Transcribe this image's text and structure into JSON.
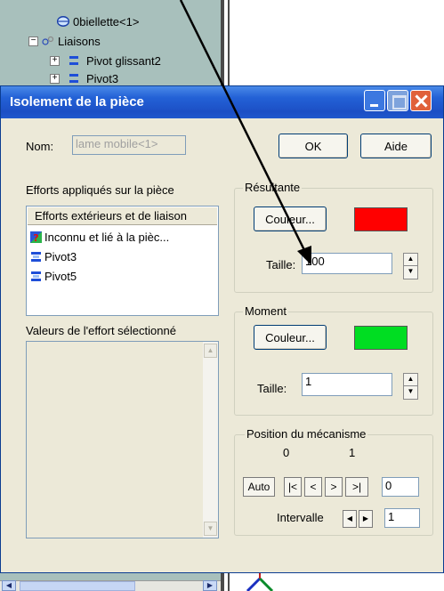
{
  "tree": {
    "items": [
      {
        "label": "0biellette<1>"
      },
      {
        "label": "Liaisons"
      },
      {
        "label": "Pivot glissant2"
      },
      {
        "label": "Pivot3"
      }
    ]
  },
  "dialog": {
    "title": "Isolement de la pièce",
    "nom_label": "Nom:",
    "nom_value": "lame mobile<1>",
    "ok_label": "OK",
    "aide_label": "Aide",
    "efforts_label": "Efforts appliqués sur la pièce",
    "list_header": "Efforts extérieurs et de liaison",
    "list_items": [
      {
        "label": "Inconnu et lié à la pièc..."
      },
      {
        "label": "Pivot3"
      },
      {
        "label": "Pivot5"
      }
    ],
    "valeurs_label": "Valeurs de l'effort sélectionné",
    "resultante": {
      "title": "Résultante",
      "couleur_label": "Couleur...",
      "color": "#ff0000",
      "taille_label": "Taille:",
      "taille_value": "100"
    },
    "moment": {
      "title": "Moment",
      "couleur_label": "Couleur...",
      "color": "#00dd22",
      "taille_label": "Taille:",
      "taille_value": "1"
    },
    "position": {
      "title": "Position du mécanisme",
      "val0": "0",
      "val1": "1",
      "auto_label": "Auto",
      "nav_first": "|<",
      "nav_prev": "<",
      "nav_next": ">",
      "nav_last": ">|",
      "step_value": "0",
      "intervalle_label": "Intervalle",
      "intervalle_value": "1"
    }
  },
  "colors": {
    "titlebar": "#2361d6",
    "tree_bg": "#a8c0bc"
  }
}
